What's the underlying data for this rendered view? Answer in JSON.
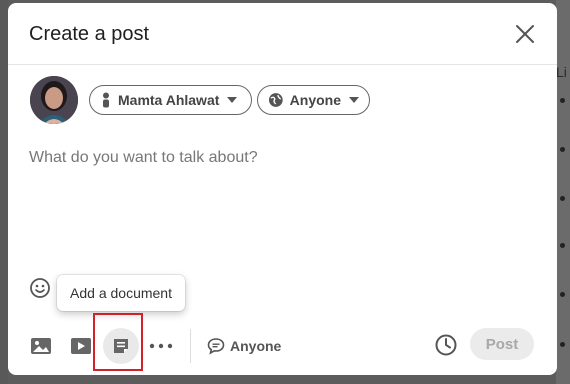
{
  "modal": {
    "title": "Create a post"
  },
  "author": {
    "name": "Mamta Ahlawat"
  },
  "audience": {
    "label": "Anyone"
  },
  "editor": {
    "placeholder": "What do you want to talk about?",
    "value": ""
  },
  "tooltip": {
    "text": "Add a document"
  },
  "toolbar": {
    "comment_control_label": "Anyone",
    "post_label": "Post"
  },
  "background": {
    "right_peek_text": "Li"
  },
  "icons": {
    "close": "close-icon",
    "person": "person-icon",
    "globe": "globe-icon",
    "emoji": "emoji-icon",
    "photo": "photo-icon",
    "video": "video-icon",
    "document": "document-icon",
    "more": "more-icon",
    "comment": "comment-icon",
    "schedule": "clock-icon"
  },
  "colors": {
    "highlight": "#d3202a",
    "post_disabled_bg": "#ebebeb",
    "post_disabled_text": "#a8a8a8"
  }
}
